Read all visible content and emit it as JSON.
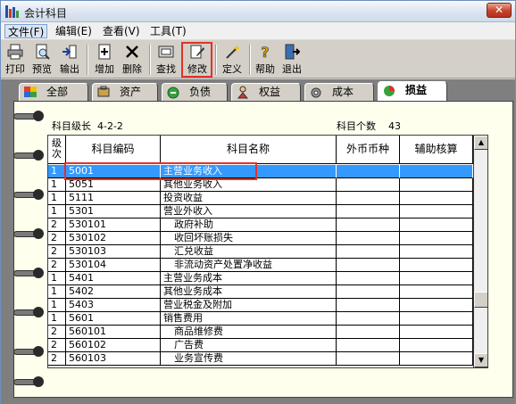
{
  "window": {
    "title": "会计科目",
    "close_glyph": "✕"
  },
  "menu": [
    {
      "label": "文件(F)"
    },
    {
      "label": "编辑(E)"
    },
    {
      "label": "查看(V)"
    },
    {
      "label": "工具(T)"
    }
  ],
  "toolbar": [
    {
      "label": "打印",
      "icon": "printer-icon"
    },
    {
      "label": "预览",
      "icon": "preview-icon"
    },
    {
      "label": "输出",
      "icon": "export-icon"
    },
    {
      "label": "增加",
      "icon": "add-icon"
    },
    {
      "label": "删除",
      "icon": "delete-icon"
    },
    {
      "label": "查找",
      "icon": "find-icon"
    },
    {
      "label": "修改",
      "icon": "edit-icon"
    },
    {
      "label": "定义",
      "icon": "define-icon"
    },
    {
      "label": "帮助",
      "icon": "help-icon"
    },
    {
      "label": "退出",
      "icon": "exit-icon"
    }
  ],
  "tabs": [
    {
      "label": "全部",
      "icon": "all-icon"
    },
    {
      "label": "资产",
      "icon": "asset-icon"
    },
    {
      "label": "负债",
      "icon": "liability-icon"
    },
    {
      "label": "权益",
      "icon": "equity-icon"
    },
    {
      "label": "成本",
      "icon": "cost-icon"
    },
    {
      "label": "损益",
      "icon": "profit-loss-icon",
      "active": true
    }
  ],
  "info": {
    "level_label": "科目级长",
    "level_value": "4-2-2",
    "count_label": "科目个数",
    "count_value": "43"
  },
  "grid": {
    "headers": {
      "level": "级次",
      "code": "科目编码",
      "name": "科目名称",
      "currency": "外币币种",
      "aux": "辅助核算"
    },
    "rows": [
      {
        "level": "1",
        "code": "5001",
        "name": "主营业务收入",
        "selected": true
      },
      {
        "level": "1",
        "code": "5051",
        "name": "其他业务收入"
      },
      {
        "level": "1",
        "code": "5111",
        "name": "投资收益"
      },
      {
        "level": "1",
        "code": "5301",
        "name": "营业外收入"
      },
      {
        "level": "2",
        "code": "530101",
        "name": "政府补助",
        "indent": true
      },
      {
        "level": "2",
        "code": "530102",
        "name": "收回坏账损失",
        "indent": true
      },
      {
        "level": "2",
        "code": "530103",
        "name": "汇兑收益",
        "indent": true
      },
      {
        "level": "2",
        "code": "530104",
        "name": "非流动资产处置净收益",
        "indent": true
      },
      {
        "level": "1",
        "code": "5401",
        "name": "主营业务成本"
      },
      {
        "level": "1",
        "code": "5402",
        "name": "其他业务成本"
      },
      {
        "level": "1",
        "code": "5403",
        "name": "营业税金及附加"
      },
      {
        "level": "1",
        "code": "5601",
        "name": "销售费用"
      },
      {
        "level": "2",
        "code": "560101",
        "name": "商品维修费",
        "indent": true
      },
      {
        "level": "2",
        "code": "560102",
        "name": "广告费",
        "indent": true
      },
      {
        "level": "2",
        "code": "560103",
        "name": "业务宣传费",
        "indent": true
      }
    ]
  },
  "colors": {
    "selection": "#3399ff",
    "highlight_box": "#e0322c",
    "notebook": "#ffffee"
  }
}
